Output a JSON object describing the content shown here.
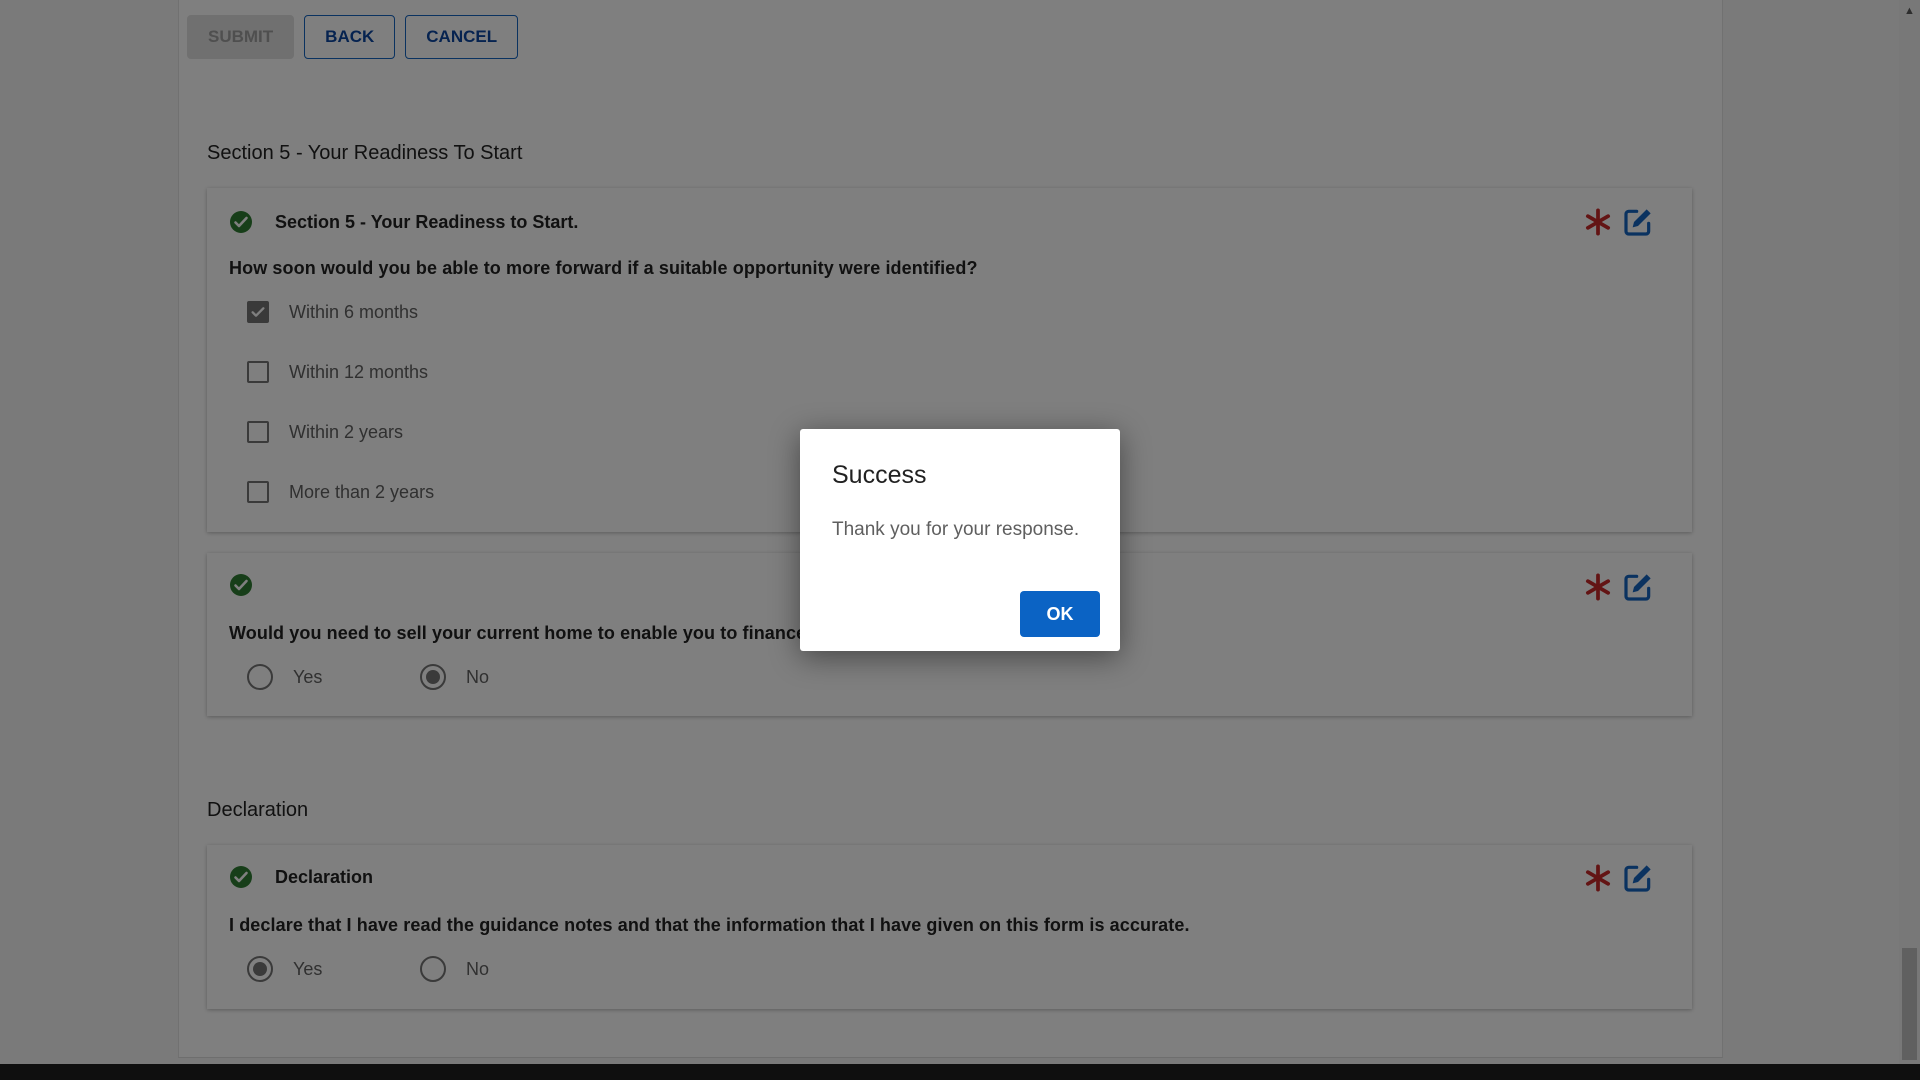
{
  "toolbar": {
    "submit_label": "SUBMIT",
    "back_label": "BACK",
    "cancel_label": "CANCEL"
  },
  "section5": {
    "heading": "Section 5 - Your Readiness To Start",
    "card1": {
      "title": "Section 5 - Your Readiness to Start.",
      "question": "How soon would you be able to more forward if a suitable opportunity were identified?",
      "options": [
        {
          "label": "Within 6 months",
          "checked": true
        },
        {
          "label": "Within 12 months",
          "checked": false
        },
        {
          "label": "Within 2 years",
          "checked": false
        },
        {
          "label": "More than 2 years",
          "checked": false
        }
      ]
    },
    "card2": {
      "title": "",
      "question": "Would you need to sell your current home to enable you to finance your s",
      "options": [
        {
          "label": "Yes",
          "selected": false
        },
        {
          "label": "No",
          "selected": true
        }
      ]
    }
  },
  "declaration": {
    "heading": "Declaration",
    "card": {
      "title": "Declaration",
      "question": "I declare that I have read the guidance notes and that the information that I have given on this form is accurate.",
      "options": [
        {
          "label": "Yes",
          "selected": true
        },
        {
          "label": "No",
          "selected": false
        }
      ]
    }
  },
  "dialog": {
    "title": "Success",
    "message": "Thank you for your response.",
    "ok_label": "OK"
  },
  "icons": {
    "check": "check-circle-icon",
    "required": "asterisk-icon",
    "edit": "edit-icon"
  },
  "colors": {
    "primary": "#0b63c4",
    "success": "#2e7d32",
    "required": "#c62828"
  }
}
